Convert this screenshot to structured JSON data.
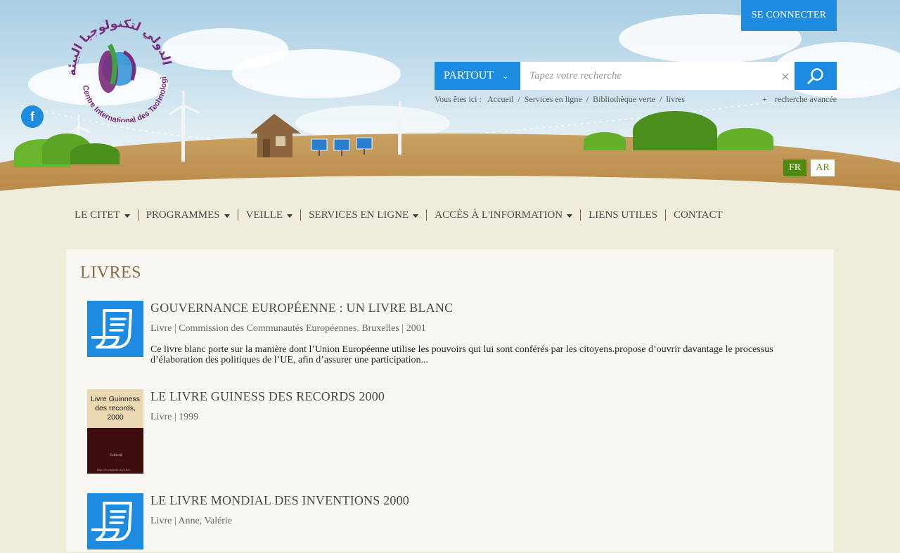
{
  "header": {
    "logo_text": "Centre International des Technologies de l'Environnement de Tunis",
    "connect_label": "SE CONNECTER",
    "social": {
      "icon": "facebook-icon",
      "glyph": "f"
    }
  },
  "search": {
    "scope": "PARTOUT",
    "placeholder": "Tapez votre recherche",
    "clear": "×",
    "advanced_label": "recherche avancée",
    "advanced_plus": "+"
  },
  "breadcrumb": {
    "prefix": "Vous êtes ici :",
    "items": [
      "Accueil",
      "Services en ligne",
      "Bibliothèque verte",
      "livres"
    ],
    "separator": "/"
  },
  "languages": [
    {
      "code": "FR",
      "active": true
    },
    {
      "code": "AR",
      "active": false
    }
  ],
  "nav": {
    "items": [
      {
        "label": "LE CITET",
        "dropdown": true
      },
      {
        "label": "PROGRAMMES",
        "dropdown": true
      },
      {
        "label": "VEILLE",
        "dropdown": true
      },
      {
        "label": "SERVICES EN LIGNE",
        "dropdown": true
      },
      {
        "label": "ACCÈS À L'INFORMATION",
        "dropdown": true
      },
      {
        "label": "LIENS UTILES",
        "dropdown": false
      },
      {
        "label": "CONTACT",
        "dropdown": false
      }
    ]
  },
  "main": {
    "title": "LIVRES",
    "books": [
      {
        "title": "GOUVERNANCE EUROPÉENNE : UN LIVRE BLANC",
        "meta": "Livre | Commission des Communautés Européennes. Bruxelles | 2001",
        "description": "Ce livre blanc porte sur la manière dont l’Union Européenne utilise les pouvoirs qui lui sont conférés par les citoyens.propose d’ouvrir davantage le processus d’élaboration des politiques de l’UE, afin d’assurer une participation...",
        "thumbnail": "document-icon"
      },
      {
        "title": "LE LIVRE GUINESS DES RECORDS 2000",
        "meta": "Livre | 1999",
        "description": "",
        "thumbnail": "book-cover",
        "cover_title": "Livre Guinness des records, 2000",
        "cover_author": "Collectif",
        "cover_footer": "https://fr.wikipedia.org/wiki/..."
      },
      {
        "title": "LE LIVRE MONDIAL DES INVENTIONS 2000",
        "meta": "Livre | Anne, Valérie",
        "description": "",
        "thumbnail": "document-icon"
      }
    ]
  },
  "colors": {
    "accent_blue": "#1d8ce0",
    "lang_active_green": "#4f8a10",
    "title_brown": "#8a6a45"
  }
}
